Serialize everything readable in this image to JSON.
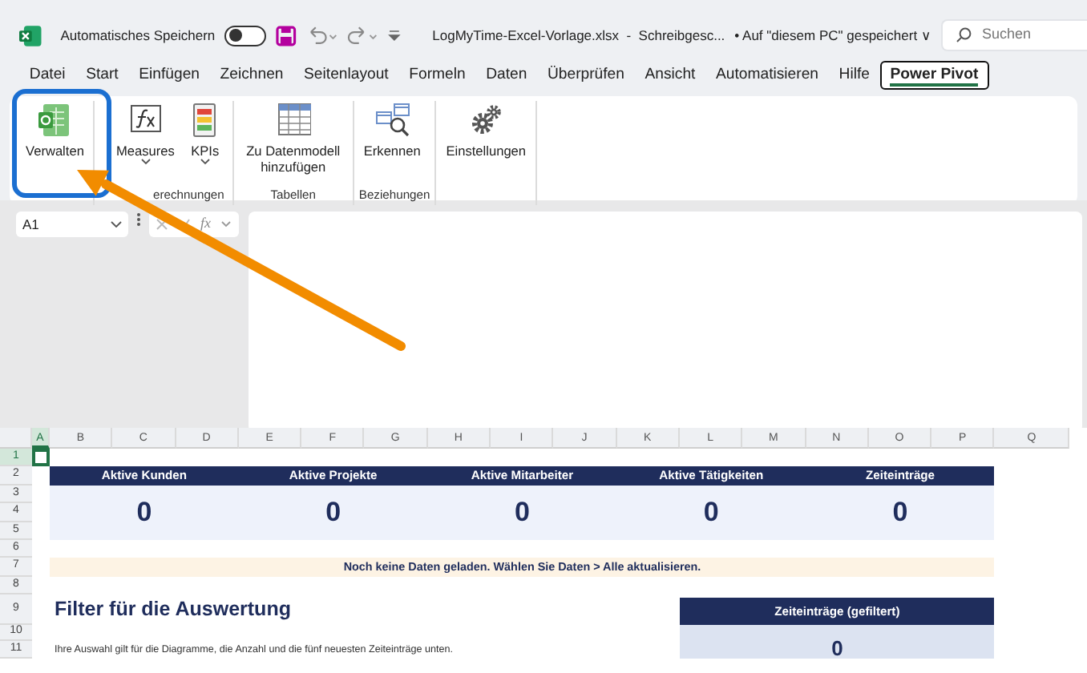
{
  "title_bar": {
    "autosave_label": "Automatisches Speichern",
    "autosave_on": false,
    "file_title": "LogMyTime-Excel-Vorlage.xlsx  -  Schreibgesc...",
    "save_location": "• Auf \"diesem PC\" gespeichert",
    "location_caret": "∨",
    "search_placeholder": "Suchen"
  },
  "menu_tabs": [
    {
      "label": "Datei",
      "selected": false
    },
    {
      "label": "Start",
      "selected": false
    },
    {
      "label": "Einfügen",
      "selected": false
    },
    {
      "label": "Zeichnen",
      "selected": false
    },
    {
      "label": "Seitenlayout",
      "selected": false
    },
    {
      "label": "Formeln",
      "selected": false
    },
    {
      "label": "Daten",
      "selected": false
    },
    {
      "label": "Überprüfen",
      "selected": false
    },
    {
      "label": "Ansicht",
      "selected": false
    },
    {
      "label": "Automatisieren",
      "selected": false
    },
    {
      "label": "Hilfe",
      "selected": false
    },
    {
      "label": "Power Pivot",
      "selected": true
    }
  ],
  "ribbon_groups": [
    {
      "buttons": [
        {
          "label": "Verwalten",
          "kind": "sheet",
          "dropdown": false
        }
      ]
    },
    {
      "label": "erechnungen",
      "buttons": [
        {
          "label": "Measures",
          "kind": "function",
          "dropdown": true
        },
        {
          "label": "KPIs",
          "kind": "kpi",
          "dropdown": true
        }
      ]
    },
    {
      "label": "Tabellen",
      "buttons": [
        {
          "label": "Zu Datenmodell hinzufügen",
          "kind": "table",
          "dropdown": false
        }
      ]
    },
    {
      "label": "Beziehungen",
      "buttons": [
        {
          "label": "Erkennen",
          "kind": "detect",
          "dropdown": false
        }
      ]
    },
    {
      "buttons": [
        {
          "label": "Einstellungen",
          "kind": "gears",
          "dropdown": false
        }
      ]
    }
  ],
  "formula_bar": {
    "name_box": "A1",
    "fx": "fx"
  },
  "columns": [
    {
      "label": "A",
      "selected": true
    },
    {
      "label": "B",
      "selected": false
    },
    {
      "label": "C",
      "selected": false
    },
    {
      "label": "D",
      "selected": false
    },
    {
      "label": "E",
      "selected": false
    },
    {
      "label": "F",
      "selected": false
    },
    {
      "label": "G",
      "selected": false
    },
    {
      "label": "H",
      "selected": false
    },
    {
      "label": "I",
      "selected": false
    },
    {
      "label": "J",
      "selected": false
    },
    {
      "label": "K",
      "selected": false
    },
    {
      "label": "L",
      "selected": false
    },
    {
      "label": "M",
      "selected": false
    },
    {
      "label": "N",
      "selected": false
    },
    {
      "label": "O",
      "selected": false
    },
    {
      "label": "P",
      "selected": false
    },
    {
      "label": "Q",
      "selected": false
    }
  ],
  "rows": [
    {
      "label": "1",
      "selected": true
    },
    {
      "label": "2",
      "selected": false
    },
    {
      "label": "3",
      "selected": false
    },
    {
      "label": "4",
      "selected": false
    },
    {
      "label": "5",
      "selected": false
    },
    {
      "label": "6",
      "selected": false
    },
    {
      "label": "7",
      "selected": false
    },
    {
      "label": "8",
      "selected": false
    },
    {
      "label": "9",
      "selected": false
    },
    {
      "label": "10",
      "selected": false
    },
    {
      "label": "11",
      "selected": false
    }
  ],
  "kpi_cards": [
    {
      "label": "Aktive Kunden",
      "value": "0"
    },
    {
      "label": "Aktive Projekte",
      "value": "0"
    },
    {
      "label": "Aktive Mitarbeiter",
      "value": "0"
    },
    {
      "label": "Aktive Tätigkeiten",
      "value": "0"
    },
    {
      "label": "Zeiteinträge",
      "value": "0"
    }
  ],
  "notice": "Noch keine Daten geladen. Wählen Sie Daten > Alle aktualisieren.",
  "filter_heading": "Filter für die Auswertung",
  "filter_note": "Ihre Auswahl gilt für die Diagramme, die Anzahl und die fünf neuesten Zeiteinträge unten.",
  "filtered_card": {
    "label": "Zeiteinträge (gefiltert)",
    "value": "0"
  }
}
